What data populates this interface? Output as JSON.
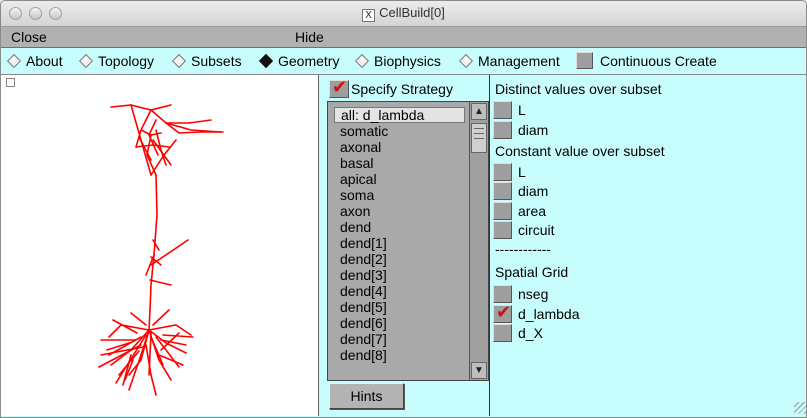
{
  "window": {
    "title": "CellBuild[0]"
  },
  "menubar": {
    "close_label": "Close",
    "hide_label": "Hide"
  },
  "tabs": [
    {
      "label": "About",
      "selected": false
    },
    {
      "label": "Topology",
      "selected": false
    },
    {
      "label": "Subsets",
      "selected": false
    },
    {
      "label": "Geometry",
      "selected": true
    },
    {
      "label": "Biophysics",
      "selected": false
    },
    {
      "label": "Management",
      "selected": false
    }
  ],
  "continuous_create": {
    "label": "Continuous Create",
    "checked": false
  },
  "strategy": {
    "label": "Specify Strategy",
    "checked": true
  },
  "subset_list": {
    "items": [
      "all:  d_lambda",
      "somatic",
      "axonal",
      "basal",
      "apical",
      "soma",
      "axon",
      "dend",
      "dend[1]",
      "dend[2]",
      "dend[3]",
      "dend[4]",
      "dend[5]",
      "dend[6]",
      "dend[7]",
      "dend[8]"
    ],
    "selected_index": 0
  },
  "hints_label": "Hints",
  "right_panel": {
    "distinct_heading": "Distinct values over subset",
    "distinct_options": [
      "L",
      "diam"
    ],
    "constant_heading": "Constant value over subset",
    "constant_options": [
      "L",
      "diam",
      "area",
      "circuit"
    ],
    "separator": "------------",
    "spatial_heading": "Spatial Grid",
    "spatial_options": [
      {
        "label": "nseg",
        "checked": false
      },
      {
        "label": "d_lambda",
        "checked": true
      },
      {
        "label": "d_X",
        "checked": false
      }
    ]
  },
  "colors": {
    "panel_bg": "#c8fdfd",
    "neuron": "#ff0000",
    "check": "#d01010"
  },
  "icons": {
    "scroll_up": "up-arrow-icon",
    "scroll_down": "down-arrow-icon",
    "title_x": "x11-icon"
  }
}
